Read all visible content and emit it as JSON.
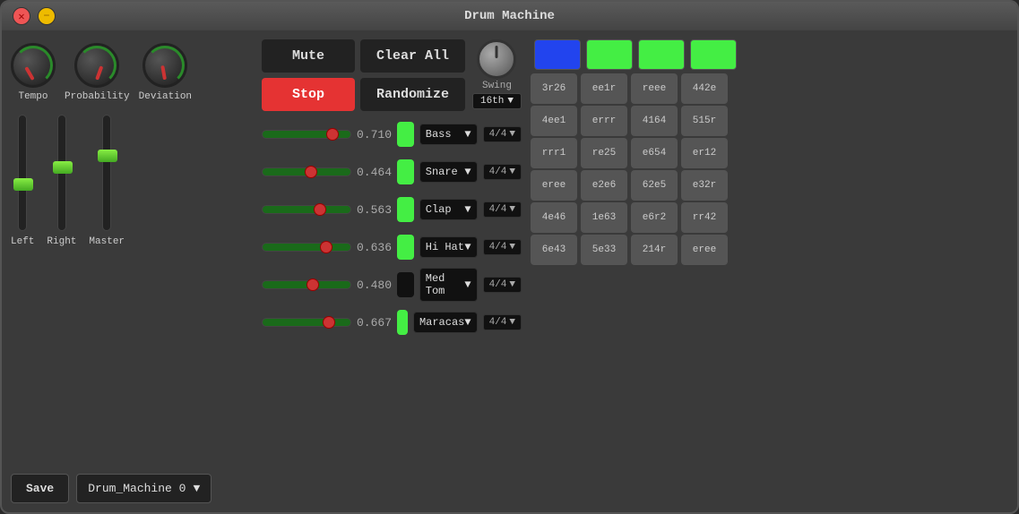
{
  "window": {
    "title": "Drum Machine",
    "close_label": "✕",
    "min_label": "−"
  },
  "knobs": [
    {
      "id": "tempo",
      "label": "Tempo"
    },
    {
      "id": "probability",
      "label": "Probability"
    },
    {
      "id": "deviation",
      "label": "Deviation"
    }
  ],
  "faders": [
    {
      "id": "left",
      "label": "Left",
      "pos_pct": 55
    },
    {
      "id": "right",
      "label": "Right",
      "pos_pct": 40
    },
    {
      "id": "master",
      "label": "Master",
      "pos_pct": 30
    }
  ],
  "buttons": {
    "mute": "Mute",
    "clear_all": "Clear All",
    "stop": "Stop",
    "randomize": "Randomize",
    "save": "Save"
  },
  "swing": {
    "label": "Swing",
    "value": "16th"
  },
  "preset": {
    "name": "Drum_Machine 0"
  },
  "tracks": [
    {
      "id": "bass",
      "name": "Bass",
      "value": "0.710",
      "slider_pct": 72,
      "active": true,
      "time_sig": "4/4",
      "steps": [
        "3r26",
        "ee1r",
        "reee",
        "442e"
      ]
    },
    {
      "id": "snare",
      "name": "Snare",
      "value": "0.464",
      "slider_pct": 48,
      "active": true,
      "time_sig": "4/4",
      "steps": [
        "4ee1",
        "errr",
        "4164",
        "515r"
      ]
    },
    {
      "id": "clap",
      "name": "Clap",
      "value": "0.563",
      "slider_pct": 58,
      "active": true,
      "time_sig": "4/4",
      "steps": [
        "rrr1",
        "re25",
        "e654",
        "er12"
      ]
    },
    {
      "id": "hihat",
      "name": "Hi Hat",
      "value": "0.636",
      "slider_pct": 65,
      "active": true,
      "time_sig": "4/4",
      "steps": [
        "eree",
        "e2e6",
        "62e5",
        "e32r"
      ]
    },
    {
      "id": "medtom",
      "name": "Med Tom",
      "value": "0.480",
      "slider_pct": 50,
      "active": false,
      "time_sig": "4/4",
      "steps": [
        "4e46",
        "1e63",
        "e6r2",
        "rr42"
      ]
    },
    {
      "id": "maracas",
      "name": "Maracas",
      "value": "0.667",
      "slider_pct": 68,
      "active": true,
      "time_sig": "4/4",
      "steps": [
        "6e43",
        "5e33",
        "214r",
        "eree"
      ]
    }
  ],
  "header_pads": [
    {
      "color": "blue"
    },
    {
      "color": "green"
    },
    {
      "color": "green"
    },
    {
      "color": "green"
    }
  ]
}
